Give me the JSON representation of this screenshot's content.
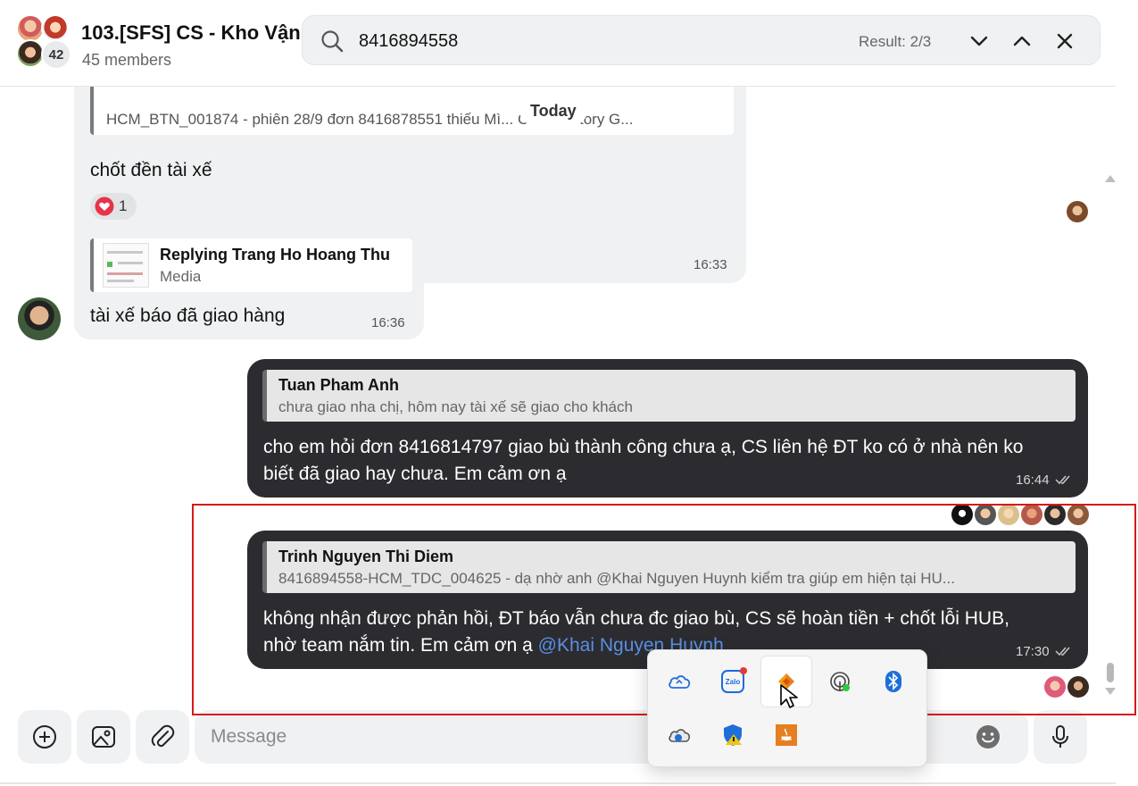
{
  "header": {
    "group_name": "103.[SFS] CS - Kho Vận",
    "members": "45 members",
    "avatar_count": "42"
  },
  "search": {
    "query": "8416894558",
    "result": "Result: 2/3"
  },
  "chat": {
    "date_divider": "Today",
    "messages": [
      {
        "quote_body": "HCM_BTN_001874 - phiên 28/9 đơn 8416878551 thiếu Mì... Chinsu Story G...",
        "text": "chốt đền tài xế",
        "reaction_count": "1",
        "time": "16:33"
      },
      {
        "quote_name": "Replying Trang Ho Hoang Thu",
        "quote_body": "Media",
        "text": "tài xế báo đã giao hàng",
        "time": "16:36"
      },
      {
        "quote_name": "Tuan Pham Anh",
        "quote_body": "chưa giao nha chị, hôm nay tài xế sẽ giao cho khách",
        "text_line1": "cho em hỏi đơn 8416814797 giao bù thành công chưa ạ, CS liên hệ ĐT ko có ở nhà nên ko",
        "text_line2": "biết đã giao hay chưa. Em cảm ơn ạ",
        "time": "16:44"
      },
      {
        "quote_name": "Trinh Nguyen Thi Diem",
        "quote_body": "8416894558-HCM_TDC_004625 - dạ nhờ anh @Khai Nguyen Huynh kiểm tra giúp em hiện tại HU...",
        "text_line1": "không nhận được phản hồi, ĐT báo vẫn chưa đc giao bù, CS sẽ hoàn tiền + chốt lỗi HUB,",
        "text_line2_prefix": "nhờ team nắm tin. Em cảm ơn ạ ",
        "mention": "@Khai Nguyen Huynh",
        "time": "17:30"
      }
    ]
  },
  "composer": {
    "placeholder": "Message"
  },
  "colors": {
    "outgoing_bubble": "#2b2b30",
    "incoming_bubble": "#f0f1f2",
    "mention": "#5a8fe0",
    "highlight_border": "#d61a1a"
  },
  "tray_icons": [
    "onedrive-icon",
    "zalo-icon",
    "app-icon",
    "network-icon",
    "bluetooth-icon",
    "onedrive-sync-icon",
    "windows-security-icon",
    "java-icon"
  ]
}
